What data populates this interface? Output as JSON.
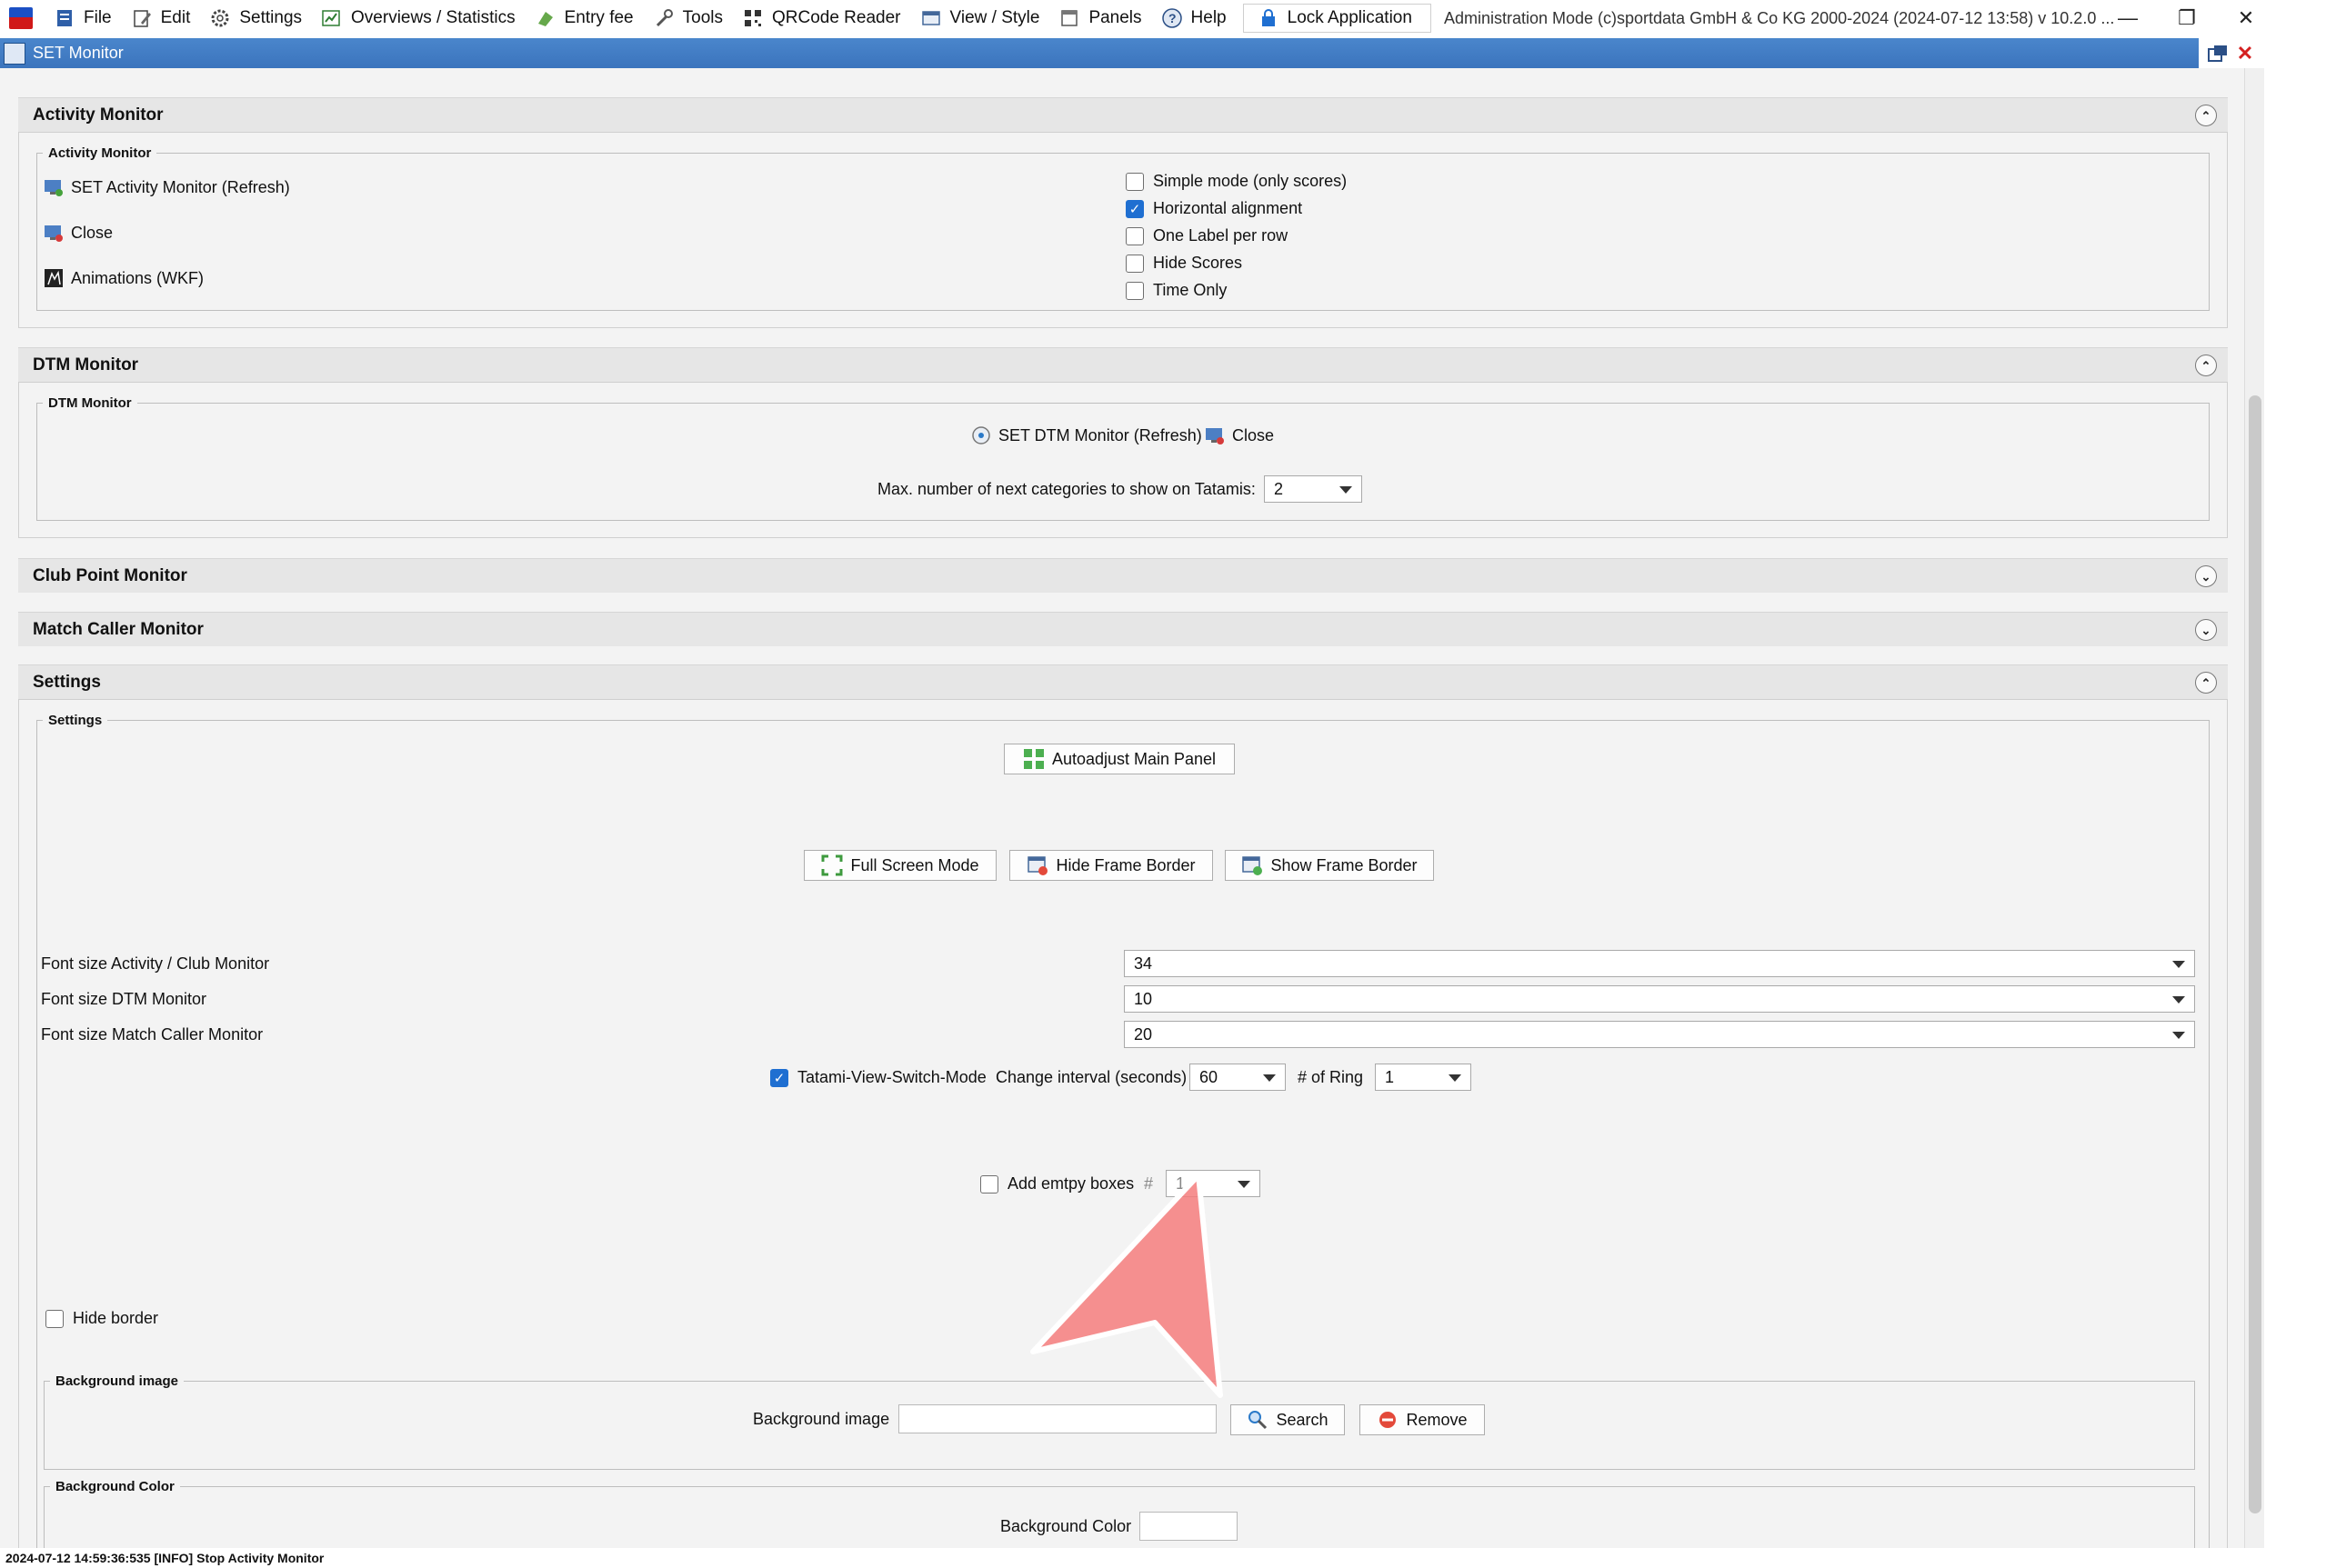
{
  "menubar": {
    "items": [
      {
        "label": "File",
        "icon": "file-icon"
      },
      {
        "label": "Edit",
        "icon": "edit-icon"
      },
      {
        "label": "Settings",
        "icon": "gear-icon"
      },
      {
        "label": "Overviews / Statistics",
        "icon": "statistics-icon"
      },
      {
        "label": "Entry fee",
        "icon": "money-icon"
      },
      {
        "label": "Tools",
        "icon": "wrench-icon"
      },
      {
        "label": "QRCode Reader",
        "icon": "qrcode-icon"
      },
      {
        "label": "View / Style",
        "icon": "view-icon"
      },
      {
        "label": "Panels",
        "icon": "panels-icon"
      },
      {
        "label": "Help",
        "icon": "help-icon"
      }
    ],
    "lock_label": "Lock Application",
    "status": "Administration Mode (c)sportdata GmbH & Co KG 2000-2024 (2024-07-12 13:58)  v 10.2.0 ..."
  },
  "window": {
    "title": "SET Monitor"
  },
  "activity_monitor": {
    "header": "Activity Monitor",
    "group_label": "Activity Monitor",
    "actions": [
      {
        "label": "SET Activity Monitor (Refresh)",
        "icon": "monitor-icon"
      },
      {
        "label": "Close",
        "icon": "close-monitor-icon"
      },
      {
        "label": "Animations (WKF)",
        "icon": "animation-icon"
      }
    ],
    "options": [
      {
        "label": "Simple mode (only scores)",
        "checked": false
      },
      {
        "label": "Horizontal alignment",
        "checked": true
      },
      {
        "label": "One Label per row",
        "checked": false
      },
      {
        "label": "Hide Scores",
        "checked": false
      },
      {
        "label": "Time Only",
        "checked": false
      }
    ]
  },
  "dtm_monitor": {
    "header": "DTM Monitor",
    "group_label": "DTM Monitor",
    "refresh_label": "SET DTM Monitor (Refresh)",
    "close_label": "Close",
    "max_next_label": "Max. number of next categories to show on Tatamis:",
    "max_next_value": "2"
  },
  "club_point_monitor": {
    "header": "Club Point Monitor"
  },
  "match_caller_monitor": {
    "header": "Match Caller Monitor"
  },
  "settings": {
    "header": "Settings",
    "group_label": "Settings",
    "autoadjust_label": "Autoadjust Main Panel",
    "full_screen_label": "Full Screen Mode",
    "hide_frame_label": "Hide Frame Border",
    "show_frame_label": "Show Frame Border",
    "font_activity_label": "Font size Activity / Club Monitor",
    "font_activity_value": "34",
    "font_dtm_label": "Font size DTM Monitor",
    "font_dtm_value": "10",
    "font_match_label": "Font size Match Caller Monitor",
    "font_match_value": "20",
    "tatami_switch_label": "Tatami-View-Switch-Mode",
    "tatami_switch_checked": true,
    "change_interval_label": "Change interval (seconds)",
    "change_interval_value": "60",
    "ring_label": "# of Ring",
    "ring_value": "1",
    "empty_boxes_label": "Add emtpy boxes",
    "empty_boxes_hash": "#",
    "empty_boxes_value": "1",
    "hide_border_label": "Hide border",
    "bg_image_group": "Background image",
    "bg_image_label": "Background image",
    "bg_image_value": "",
    "search_label": "Search",
    "remove_label": "Remove",
    "bg_color_group": "Background Color",
    "bg_color_label": "Background Color"
  },
  "statusbar": {
    "text": "2024-07-12 14:59:36:535 [INFO] Stop Activity Monitor"
  },
  "colors": {
    "title_bar": "#3b74bd",
    "checkbox_checked": "#1f6fd1",
    "annotation_arrow": "#f47c7c"
  }
}
